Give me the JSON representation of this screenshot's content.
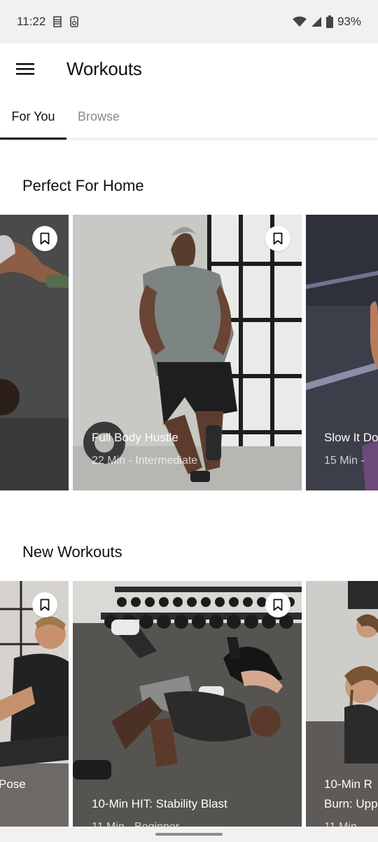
{
  "status_bar": {
    "time": "11:22",
    "battery": "93%",
    "icons": [
      "film-icon",
      "speaker-icon",
      "wifi-icon",
      "signal-icon",
      "battery-icon"
    ]
  },
  "header": {
    "menu_icon": "hamburger-menu-icon",
    "title": "Workouts"
  },
  "tabs": [
    {
      "label": "For You",
      "active": true
    },
    {
      "label": "Browse",
      "active": false
    }
  ],
  "sections": [
    {
      "title": "Perfect For Home",
      "cards": [
        {
          "title": "",
          "meta": ""
        },
        {
          "title": "Full Body Hustle",
          "meta": "22 Min - Intermediate"
        },
        {
          "title": "Slow It Do",
          "meta": "15 Min -"
        }
      ]
    },
    {
      "title": "New Workouts",
      "cards": [
        {
          "title": "Pose",
          "meta": ""
        },
        {
          "title": "10-Min HIT: Stability Blast",
          "meta": "11 Min - Beginner"
        },
        {
          "title": "10-Min R",
          "title_line2": "Burn: Upp",
          "meta": "11 Min"
        }
      ]
    }
  ],
  "colors": {
    "accent": "#111111",
    "inactive_tab": "#8a8a8a",
    "status_bar_bg": "#f1f1f1"
  }
}
